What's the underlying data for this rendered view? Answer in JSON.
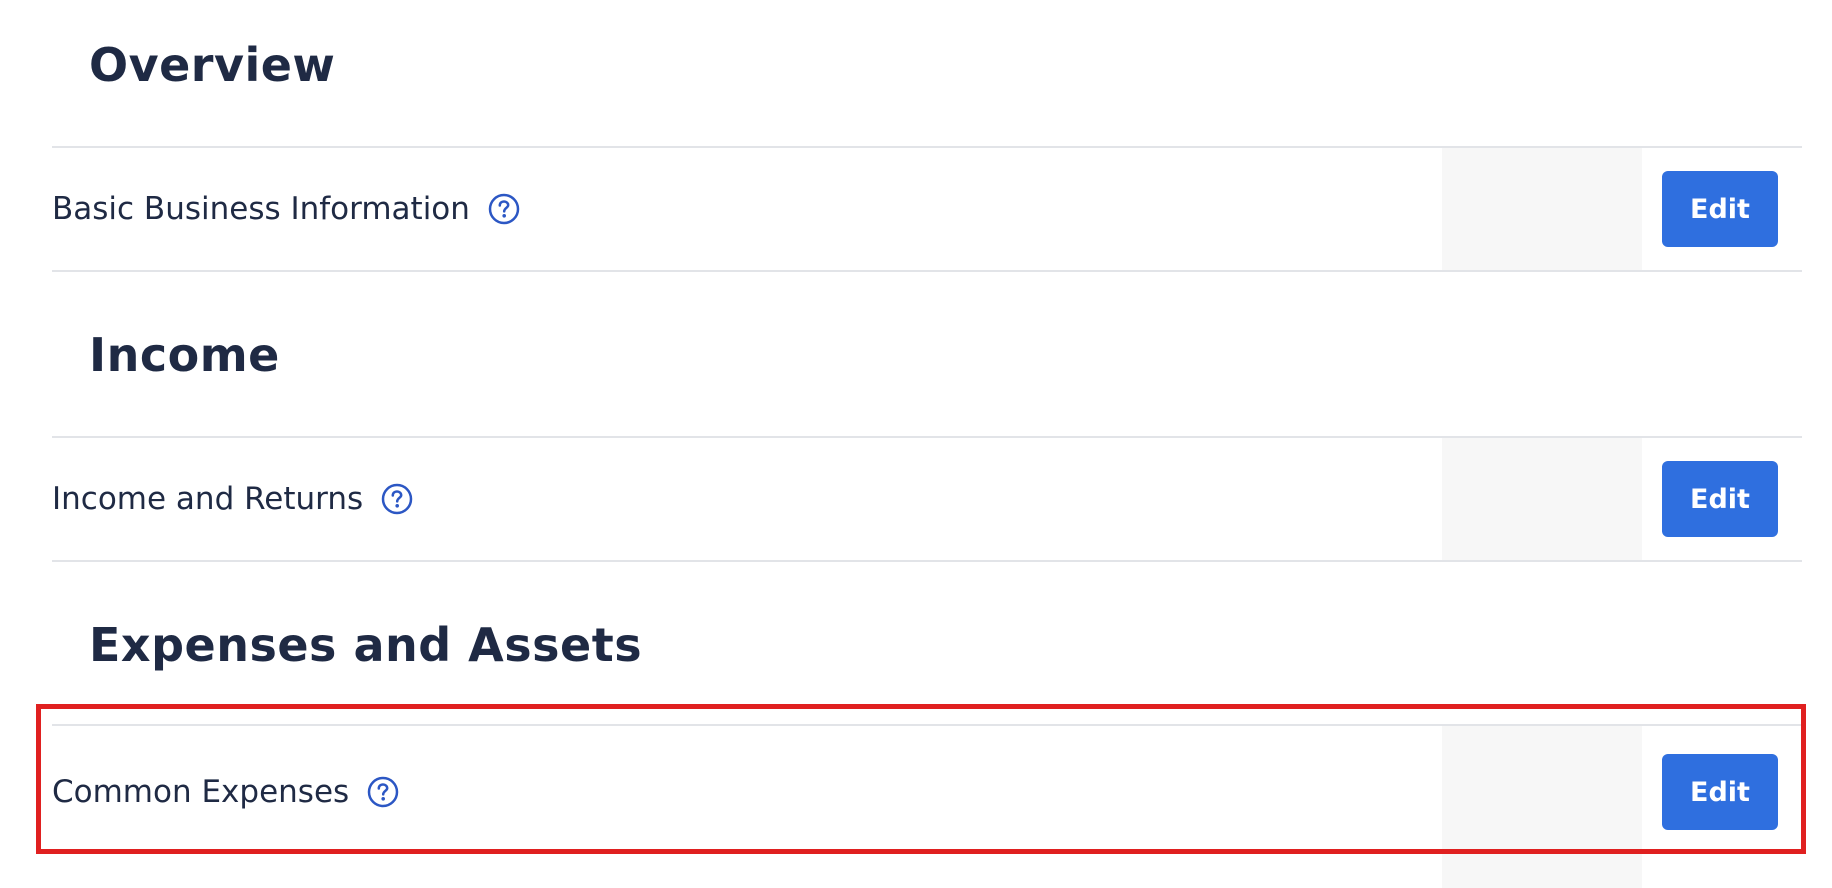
{
  "sections": [
    {
      "title": "Overview",
      "rows": [
        {
          "label": "Basic Business Information",
          "button": "Edit"
        }
      ]
    },
    {
      "title": "Income",
      "rows": [
        {
          "label": "Income and Returns",
          "button": "Edit"
        }
      ]
    },
    {
      "title": "Expenses and Assets",
      "rows": [
        {
          "label": "Common Expenses",
          "button": "Edit",
          "highlighted": true
        }
      ]
    }
  ],
  "colors": {
    "heading_text": "#1f2a44",
    "button_bg": "#2f6fdf",
    "button_text": "#ffffff",
    "help_icon": "#2c57c4",
    "divider": "#e2e4e8",
    "highlight_border": "#e02020",
    "status_column_bg": "#f7f7f7"
  },
  "icons": {
    "help": "question-circle-icon"
  }
}
